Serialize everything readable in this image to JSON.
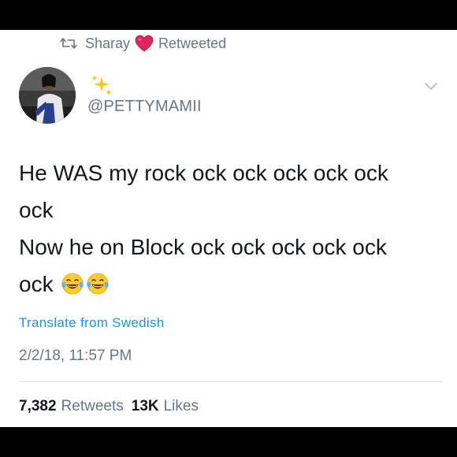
{
  "retweet_context": {
    "icon": "retweet-icon",
    "user": "Sharay",
    "heart_icon": "red-heart-icon",
    "label": "Retweeted"
  },
  "author": {
    "avatar": "profile-photo",
    "name_emoji": "sparkles-icon",
    "handle": "@PETTYMAMII"
  },
  "tweet": {
    "lines": [
      "He WAS my rock ock ock ock ock ock",
      "ock",
      "Now he on Block ock ock ock ock ock",
      "ock"
    ],
    "emoji": [
      "face-with-tears-of-joy-icon",
      "face-with-tears-of-joy-icon"
    ],
    "translate": "Translate from Swedish",
    "timestamp": "2/2/18, 11:57 PM"
  },
  "stats": {
    "retweets_count": "7,382",
    "retweets_label": "Retweets",
    "likes_count": "13K",
    "likes_label": "Likes"
  },
  "colors": {
    "text": "#14171a",
    "muted": "#657786",
    "link": "#1b95e0",
    "heart": "#e0245e",
    "divider": "#e1e8ed"
  }
}
